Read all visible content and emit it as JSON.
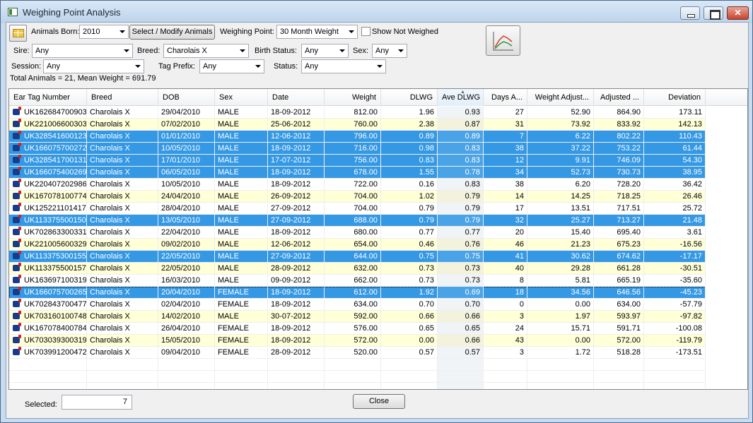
{
  "window": {
    "title": "Weighing Point Analysis"
  },
  "filters": {
    "animals_born_label": "Animals Born:",
    "animals_born_value": "2010",
    "select_modify_label": "Select / Modify Animals",
    "weighing_point_label": "Weighing Point:",
    "weighing_point_value": "30 Month Weight",
    "show_not_weighed_label": "Show Not Weighed",
    "sire_label": "Sire:",
    "sire_value": "Any",
    "breed_label": "Breed:",
    "breed_value": "Charolais X",
    "birth_status_label": "Birth Status:",
    "birth_status_value": "Any",
    "sex_label": "Sex:",
    "sex_value": "Any",
    "session_label": "Session:",
    "session_value": "Any",
    "tag_prefix_label": "Tag Prefix:",
    "tag_prefix_value": "Any",
    "status_label": "Status:",
    "status_value": "Any",
    "summary": "Total Animals = 21, Mean Weight = 691.79"
  },
  "table": {
    "columns": [
      "Ear Tag Number",
      "Breed",
      "DOB",
      "Sex",
      "Date",
      "Weight",
      "DLWG",
      "Ave DLWG",
      "Days A...",
      "Weight Adjust...",
      "Adjusted ...",
      "Deviation"
    ],
    "rows": [
      {
        "tag": "UK162684700903",
        "breed": "Charolais X",
        "dob": "29/04/2010",
        "sex": "MALE",
        "date": "18-09-2012",
        "weight": "812.00",
        "dlwg": "1.96",
        "ave": "0.93",
        "days": "27",
        "wadj": "52.90",
        "adj": "864.90",
        "dev": "173.11",
        "style": "plain"
      },
      {
        "tag": "UK221006600303",
        "breed": "Charolais X",
        "dob": "07/02/2010",
        "sex": "MALE",
        "date": "25-06-2012",
        "weight": "760.00",
        "dlwg": "2.38",
        "ave": "0.87",
        "days": "31",
        "wadj": "73.92",
        "adj": "833.92",
        "dev": "142.13",
        "style": "alt"
      },
      {
        "tag": "UK328541600123",
        "breed": "Charolais X",
        "dob": "01/01/2010",
        "sex": "MALE",
        "date": "12-06-2012",
        "weight": "796.00",
        "dlwg": "0.89",
        "ave": "0.89",
        "days": "7",
        "wadj": "6.22",
        "adj": "802.22",
        "dev": "110.43",
        "style": "sel"
      },
      {
        "tag": "UK166075700272",
        "breed": "Charolais X",
        "dob": "10/05/2010",
        "sex": "MALE",
        "date": "18-09-2012",
        "weight": "716.00",
        "dlwg": "0.98",
        "ave": "0.83",
        "days": "38",
        "wadj": "37.22",
        "adj": "753.22",
        "dev": "61.44",
        "style": "sel"
      },
      {
        "tag": "UK328541700131",
        "breed": "Charolais X",
        "dob": "17/01/2010",
        "sex": "MALE",
        "date": "17-07-2012",
        "weight": "756.00",
        "dlwg": "0.83",
        "ave": "0.83",
        "days": "12",
        "wadj": "9.91",
        "adj": "746.09",
        "dev": "54.30",
        "style": "sel"
      },
      {
        "tag": "UK166075400269",
        "breed": "Charolais X",
        "dob": "06/05/2010",
        "sex": "MALE",
        "date": "18-09-2012",
        "weight": "678.00",
        "dlwg": "1.55",
        "ave": "0.78",
        "days": "34",
        "wadj": "52.73",
        "adj": "730.73",
        "dev": "38.95",
        "style": "sel"
      },
      {
        "tag": "UK220407202986",
        "breed": "Charolais X",
        "dob": "10/05/2010",
        "sex": "MALE",
        "date": "18-09-2012",
        "weight": "722.00",
        "dlwg": "0.16",
        "ave": "0.83",
        "days": "38",
        "wadj": "6.20",
        "adj": "728.20",
        "dev": "36.42",
        "style": "plain"
      },
      {
        "tag": "UK167078100774",
        "breed": "Charolais X",
        "dob": "24/04/2010",
        "sex": "MALE",
        "date": "26-09-2012",
        "weight": "704.00",
        "dlwg": "1.02",
        "ave": "0.79",
        "days": "14",
        "wadj": "14.25",
        "adj": "718.25",
        "dev": "26.46",
        "style": "alt"
      },
      {
        "tag": "UK125221101417",
        "breed": "Charolais X",
        "dob": "28/04/2010",
        "sex": "MALE",
        "date": "27-09-2012",
        "weight": "704.00",
        "dlwg": "0.79",
        "ave": "0.79",
        "days": "17",
        "wadj": "13.51",
        "adj": "717.51",
        "dev": "25.72",
        "style": "plain"
      },
      {
        "tag": "UK113375500150",
        "breed": "Charolais X",
        "dob": "13/05/2010",
        "sex": "MALE",
        "date": "27-09-2012",
        "weight": "688.00",
        "dlwg": "0.79",
        "ave": "0.79",
        "days": "32",
        "wadj": "25.27",
        "adj": "713.27",
        "dev": "21.48",
        "style": "sel"
      },
      {
        "tag": "UK702863300331",
        "breed": "Charolais X",
        "dob": "22/04/2010",
        "sex": "MALE",
        "date": "18-09-2012",
        "weight": "680.00",
        "dlwg": "0.77",
        "ave": "0.77",
        "days": "20",
        "wadj": "15.40",
        "adj": "695.40",
        "dev": "3.61",
        "style": "plain"
      },
      {
        "tag": "UK221005600329",
        "breed": "Charolais X",
        "dob": "09/02/2010",
        "sex": "MALE",
        "date": "12-06-2012",
        "weight": "654.00",
        "dlwg": "0.46",
        "ave": "0.76",
        "days": "46",
        "wadj": "21.23",
        "adj": "675.23",
        "dev": "-16.56",
        "style": "alt"
      },
      {
        "tag": "UK113375300155",
        "breed": "Charolais X",
        "dob": "22/05/2010",
        "sex": "MALE",
        "date": "27-09-2012",
        "weight": "644.00",
        "dlwg": "0.75",
        "ave": "0.75",
        "days": "41",
        "wadj": "30.62",
        "adj": "674.62",
        "dev": "-17.17",
        "style": "sel"
      },
      {
        "tag": "UK113375500157",
        "breed": "Charolais X",
        "dob": "22/05/2010",
        "sex": "MALE",
        "date": "28-09-2012",
        "weight": "632.00",
        "dlwg": "0.73",
        "ave": "0.73",
        "days": "40",
        "wadj": "29.28",
        "adj": "661.28",
        "dev": "-30.51",
        "style": "alt"
      },
      {
        "tag": "UK163697100319",
        "breed": "Charolais X",
        "dob": "16/03/2010",
        "sex": "MALE",
        "date": "09-09-2012",
        "weight": "662.00",
        "dlwg": "0.73",
        "ave": "0.73",
        "days": "8",
        "wadj": "5.81",
        "adj": "665.19",
        "dev": "-35.60",
        "style": "plain"
      },
      {
        "tag": "UK166075700265",
        "breed": "Charolais X",
        "dob": "20/04/2010",
        "sex": "FEMALE",
        "date": "18-09-2012",
        "weight": "612.00",
        "dlwg": "1.92",
        "ave": "0.69",
        "days": "18",
        "wadj": "34.56",
        "adj": "646.56",
        "dev": "-45.23",
        "style": "sel focus"
      },
      {
        "tag": "UK702843700477",
        "breed": "Charolais X",
        "dob": "02/04/2010",
        "sex": "FEMALE",
        "date": "18-09-2012",
        "weight": "634.00",
        "dlwg": "0.70",
        "ave": "0.70",
        "days": "0",
        "wadj": "0.00",
        "adj": "634.00",
        "dev": "-57.79",
        "style": "plain"
      },
      {
        "tag": "UK703160100748",
        "breed": "Charolais X",
        "dob": "14/02/2010",
        "sex": "MALE",
        "date": "30-07-2012",
        "weight": "592.00",
        "dlwg": "0.66",
        "ave": "0.66",
        "days": "3",
        "wadj": "1.97",
        "adj": "593.97",
        "dev": "-97.82",
        "style": "alt"
      },
      {
        "tag": "UK167078400784",
        "breed": "Charolais X",
        "dob": "26/04/2010",
        "sex": "FEMALE",
        "date": "18-09-2012",
        "weight": "576.00",
        "dlwg": "0.65",
        "ave": "0.65",
        "days": "24",
        "wadj": "15.71",
        "adj": "591.71",
        "dev": "-100.08",
        "style": "plain"
      },
      {
        "tag": "UK703039300319",
        "breed": "Charolais X",
        "dob": "15/05/2010",
        "sex": "FEMALE",
        "date": "18-09-2012",
        "weight": "572.00",
        "dlwg": "0.00",
        "ave": "0.66",
        "days": "43",
        "wadj": "0.00",
        "adj": "572.00",
        "dev": "-119.79",
        "style": "alt"
      },
      {
        "tag": "UK703991200472",
        "breed": "Charolais X",
        "dob": "09/04/2010",
        "sex": "FEMALE",
        "date": "28-09-2012",
        "weight": "520.00",
        "dlwg": "0.57",
        "ave": "0.57",
        "days": "3",
        "wadj": "1.72",
        "adj": "518.28",
        "dev": "-173.51",
        "style": "plain"
      }
    ]
  },
  "footer": {
    "selected_label": "Selected:",
    "selected_value": "7",
    "close_label": "Close"
  },
  "colors": {
    "selection": "#3498e4",
    "alt_row": "#ffffd8",
    "chart_line_red": "#d43a2a",
    "chart_line_green": "#2e9a3a"
  },
  "icons": {
    "calendar": "calendar-icon",
    "graph": "line-graph-icon",
    "animal": "cow-icon"
  }
}
